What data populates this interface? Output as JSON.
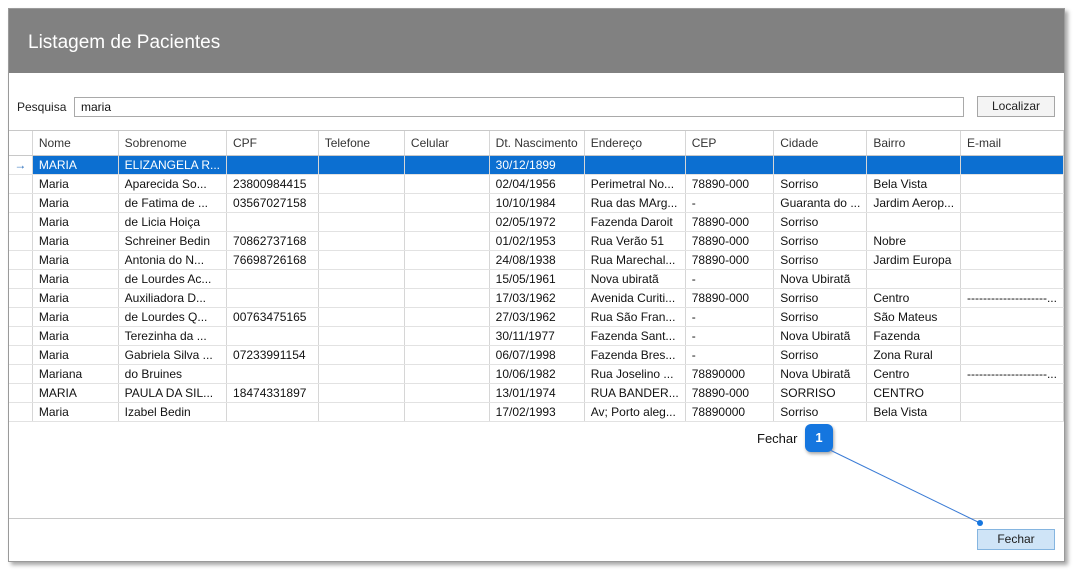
{
  "window": {
    "title": "Listagem de Pacientes"
  },
  "search": {
    "label": "Pesquisa",
    "value": "maria",
    "button_label": "Localizar"
  },
  "grid": {
    "columns": [
      "Nome",
      "Sobrenome",
      "CPF",
      "Telefone",
      "Celular",
      "Dt. Nascimento",
      "Endereço",
      "CEP",
      "Cidade",
      "Bairro",
      "E-mail"
    ],
    "current_row_indicator": "→",
    "rows": [
      [
        "MARIA",
        "ELIZANGELA R...",
        "",
        "",
        "",
        "30/12/1899",
        "",
        "",
        "",
        "",
        ""
      ],
      [
        "Maria",
        "Aparecida So...",
        "23800984415",
        "",
        "",
        "02/04/1956",
        "Perimetral No...",
        "78890-000",
        "Sorriso",
        "Bela Vista",
        ""
      ],
      [
        "Maria",
        "de Fatima de ...",
        "03567027158",
        "",
        "",
        "10/10/1984",
        "Rua das MArg...",
        "   -",
        "Guaranta do ...",
        "Jardim Aerop...",
        ""
      ],
      [
        "Maria",
        "de Licia Hoiça",
        "",
        "",
        "",
        "02/05/1972",
        "Fazenda  Daroit",
        "78890-000",
        "Sorriso",
        "",
        ""
      ],
      [
        "Maria",
        "Schreiner Bedin",
        "70862737168",
        "",
        "",
        "01/02/1953",
        "Rua Verão 51",
        "78890-000",
        "Sorriso",
        "Nobre",
        ""
      ],
      [
        "Maria",
        "Antonia do N...",
        "76698726168",
        "",
        "",
        "24/08/1938",
        "Rua Marechal...",
        "78890-000",
        "Sorriso",
        "Jardim Europa",
        ""
      ],
      [
        "Maria",
        "de Lourdes Ac...",
        "",
        "",
        "",
        "15/05/1961",
        "Nova ubiratã",
        "   -",
        "Nova Ubiratã",
        "",
        ""
      ],
      [
        "Maria",
        "Auxiliadora D...",
        "",
        "",
        "",
        "17/03/1962",
        "Avenida Curiti...",
        "78890-000",
        "Sorriso",
        "Centro",
        "--------------------..."
      ],
      [
        "Maria",
        "de Lourdes Q...",
        "00763475165",
        "",
        "",
        "27/03/1962",
        "Rua São Fran...",
        "-",
        "Sorriso",
        "São Mateus",
        ""
      ],
      [
        "Maria",
        "Terezinha da ...",
        "",
        "",
        "",
        "30/11/1977",
        "Fazenda Sant...",
        "-",
        "Nova Ubiratã",
        "Fazenda",
        ""
      ],
      [
        "Maria",
        "Gabriela Silva ...",
        "07233991154",
        "",
        "",
        "06/07/1998",
        "Fazenda Bres...",
        "-",
        "Sorriso",
        "Zona Rural",
        ""
      ],
      [
        "Mariana",
        "do Bruines",
        "",
        "",
        "",
        "10/06/1982",
        "Rua Joselino ...",
        "78890000",
        "Nova Ubiratã",
        "Centro",
        "--------------------..."
      ],
      [
        "MARIA",
        "PAULA DA SIL...",
        "18474331897",
        "",
        "",
        "13/01/1974",
        "RUA BANDER...",
        "78890-000",
        "SORRISO",
        "CENTRO",
        ""
      ],
      [
        "Maria",
        "Izabel Bedin",
        "",
        "",
        "",
        "17/02/1993",
        "Av; Porto aleg...",
        "78890000",
        "Sorriso",
        "Bela Vista",
        ""
      ]
    ]
  },
  "callout": {
    "label": "Fechar",
    "number": "1"
  },
  "footer": {
    "close_button_label": "Fechar"
  },
  "colors": {
    "title_bar": "#818181",
    "selection": "#0c6fd1",
    "callout_badge": "#1576df",
    "close_button": "#cfe4f7"
  }
}
